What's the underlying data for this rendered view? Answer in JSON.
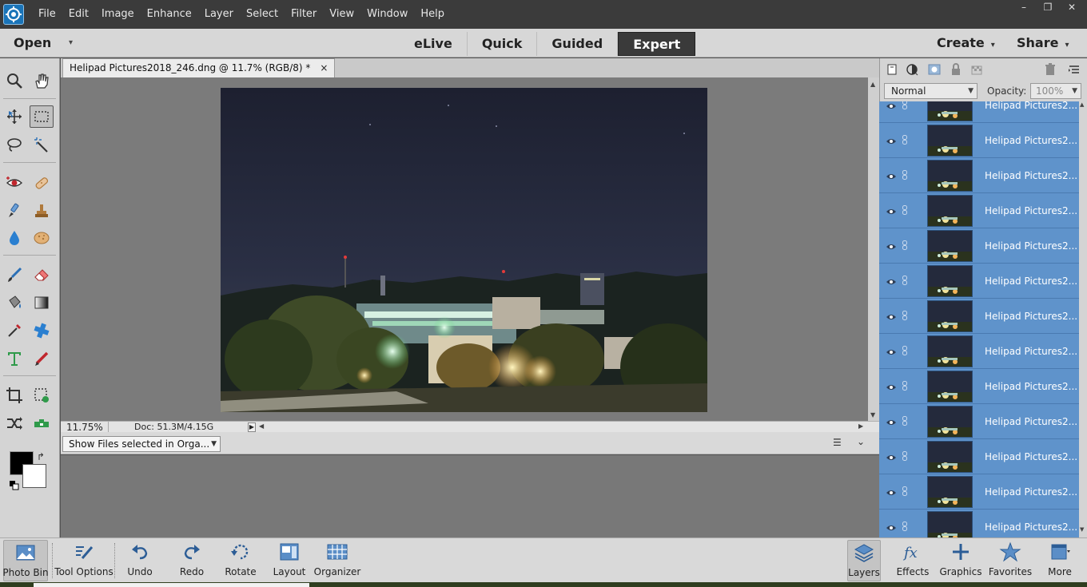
{
  "menu": [
    "File",
    "Edit",
    "Image",
    "Enhance",
    "Layer",
    "Select",
    "Filter",
    "View",
    "Window",
    "Help"
  ],
  "window_controls": {
    "minimize": "–",
    "restore": "❐",
    "close": "✕"
  },
  "modebar": {
    "open_label": "Open",
    "dropdown_glyph": "▾",
    "modes": [
      "eLive",
      "Quick",
      "Guided",
      "Expert"
    ],
    "active_mode": "Expert",
    "create_label": "Create",
    "share_label": "Share"
  },
  "document": {
    "tab_title": "Helipad Pictures2018_246.dng @ 11.7% (RGB/8) *",
    "tab_close": "×",
    "zoom": "11.75%",
    "doc_info": "Doc: 51.3M/4.15G",
    "status_arrow": "▶"
  },
  "photo_bin": {
    "show_files": "Show Files selected in Orga...",
    "menu_glyph": "☰",
    "collapse_glyph": "⌄"
  },
  "layers_panel": {
    "blend_mode": "Normal",
    "opacity_label": "Opacity:",
    "opacity_value": "100%",
    "layers": [
      {
        "name": "Helipad Pictures2..."
      },
      {
        "name": "Helipad Pictures2..."
      },
      {
        "name": "Helipad Pictures2..."
      },
      {
        "name": "Helipad Pictures2..."
      },
      {
        "name": "Helipad Pictures2..."
      },
      {
        "name": "Helipad Pictures2..."
      },
      {
        "name": "Helipad Pictures2..."
      },
      {
        "name": "Helipad Pictures2..."
      },
      {
        "name": "Helipad Pictures2..."
      },
      {
        "name": "Helipad Pictures2..."
      },
      {
        "name": "Helipad Pictures2..."
      },
      {
        "name": "Helipad Pictures2..."
      }
    ]
  },
  "taskbar": {
    "photo_bin": "Photo Bin",
    "tool_options": "Tool Options",
    "undo": "Undo",
    "redo": "Redo",
    "rotate": "Rotate",
    "layout": "Layout",
    "organizer": "Organizer",
    "layers": "Layers",
    "effects": "Effects",
    "graphics": "Graphics",
    "favorites": "Favorites",
    "more": "More"
  },
  "colors": {
    "accent_blue": "#5f93cb",
    "active_mode_bg": "#3a3a3a",
    "foreground": "#000000",
    "background": "#ffffff"
  }
}
